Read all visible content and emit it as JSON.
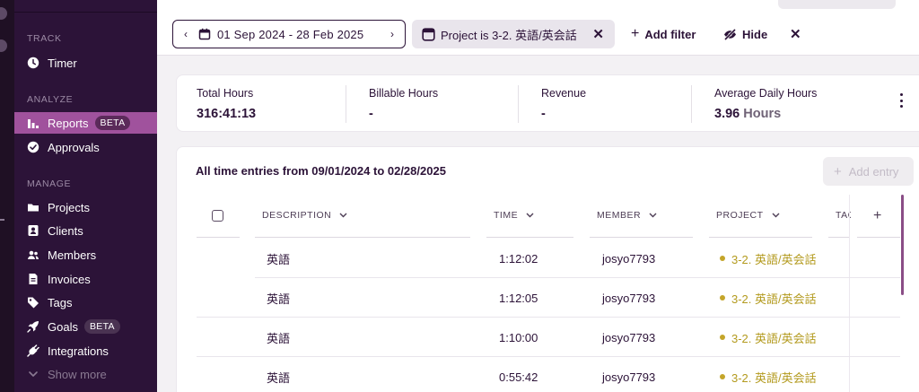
{
  "sidebar": {
    "sections": {
      "track": "TRACK",
      "analyze": "ANALYZE",
      "manage": "MANAGE"
    },
    "items": [
      {
        "label": "Timer",
        "icon": "clock-icon"
      },
      {
        "label": "Reports",
        "icon": "bar-chart-icon",
        "badge": "BETA",
        "active": true
      },
      {
        "label": "Approvals",
        "icon": "check-circle-icon"
      },
      {
        "label": "Projects",
        "icon": "folder-icon"
      },
      {
        "label": "Clients",
        "icon": "contact-card-icon"
      },
      {
        "label": "Members",
        "icon": "people-icon"
      },
      {
        "label": "Invoices",
        "icon": "invoice-icon"
      },
      {
        "label": "Tags",
        "icon": "tag-icon"
      },
      {
        "label": "Goals",
        "icon": "rocket-icon",
        "badge": "BETA"
      },
      {
        "label": "Integrations",
        "icon": "plug-icon"
      },
      {
        "label": "Show more",
        "icon": "chevron-down-icon"
      }
    ]
  },
  "toolbar": {
    "date_range": "01 Sep 2024 - 28 Feb 2025",
    "filter_label": "Project is 3-2. 英語/英会話",
    "add_filter": "Add filter",
    "hide": "Hide"
  },
  "summary": {
    "total_hours_label": "Total Hours",
    "total_hours_value": "316:41:13",
    "billable_label": "Billable Hours",
    "billable_value": "-",
    "revenue_label": "Revenue",
    "revenue_value": "-",
    "avg_label": "Average Daily Hours",
    "avg_value": "3.96",
    "avg_unit": "Hours"
  },
  "entries": {
    "title": "All time entries from 09/01/2024 to 02/28/2025",
    "add_entry": "Add entry",
    "columns": {
      "description": "DESCRIPTION",
      "time": "TIME",
      "member": "MEMBER",
      "project": "PROJECT",
      "tags": "TAG"
    },
    "rows": [
      {
        "description": "英語",
        "time": "1:12:02",
        "member": "josyo7793",
        "project": "3-2. 英語/英会話"
      },
      {
        "description": "英語",
        "time": "1:12:05",
        "member": "josyo7793",
        "project": "3-2. 英語/英会話"
      },
      {
        "description": "英語",
        "time": "1:10:00",
        "member": "josyo7793",
        "project": "3-2. 英語/英会話"
      },
      {
        "description": "英語",
        "time": "0:55:42",
        "member": "josyo7793",
        "project": "3-2. 英語/英会話"
      }
    ]
  },
  "colors": {
    "sidebar_bg": "#2c1338",
    "active_item": "#a0529d",
    "project_color": "#c4a52a",
    "text_primary": "#2c1338"
  }
}
